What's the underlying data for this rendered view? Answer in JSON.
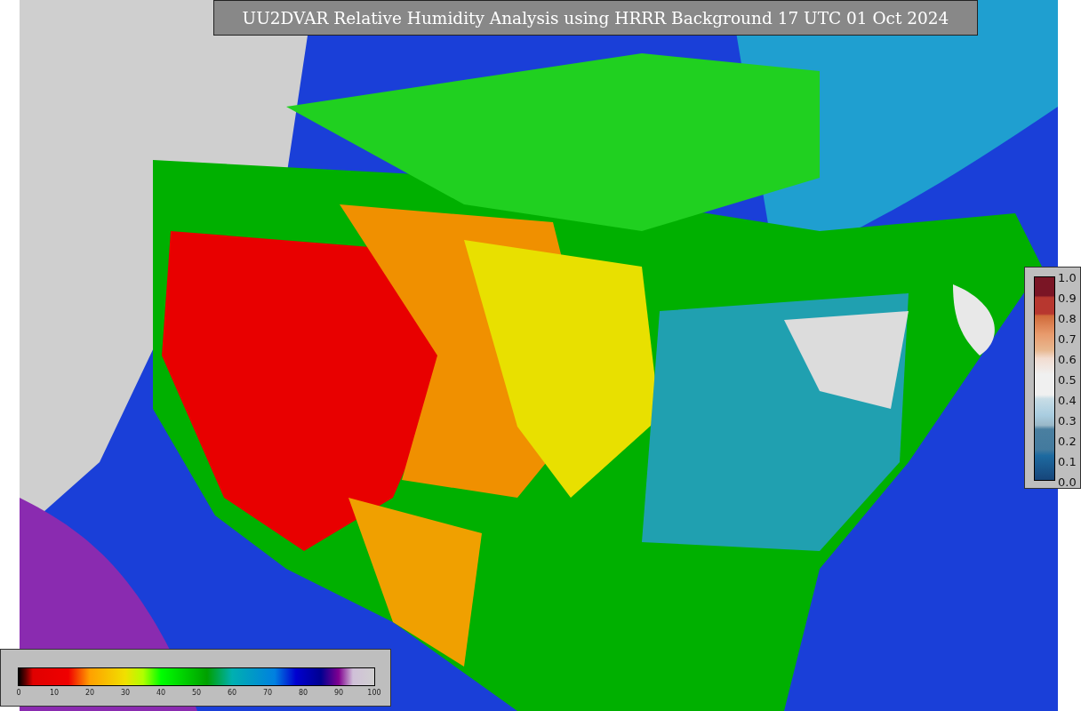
{
  "title": "UU2DVAR Relative Humidity Analysis using HRRR Background 17 UTC 01 Oct 2024",
  "legend_right": {
    "ticks": [
      "1.0",
      "0.9",
      "0.8",
      "0.7",
      "0.6",
      "0.5",
      "0.4",
      "0.3",
      "0.2",
      "0.1",
      "0.0"
    ]
  },
  "legend_bottom": {
    "ticks": [
      "0",
      "10",
      "20",
      "30",
      "40",
      "50",
      "60",
      "70",
      "80",
      "90",
      "100"
    ]
  }
}
